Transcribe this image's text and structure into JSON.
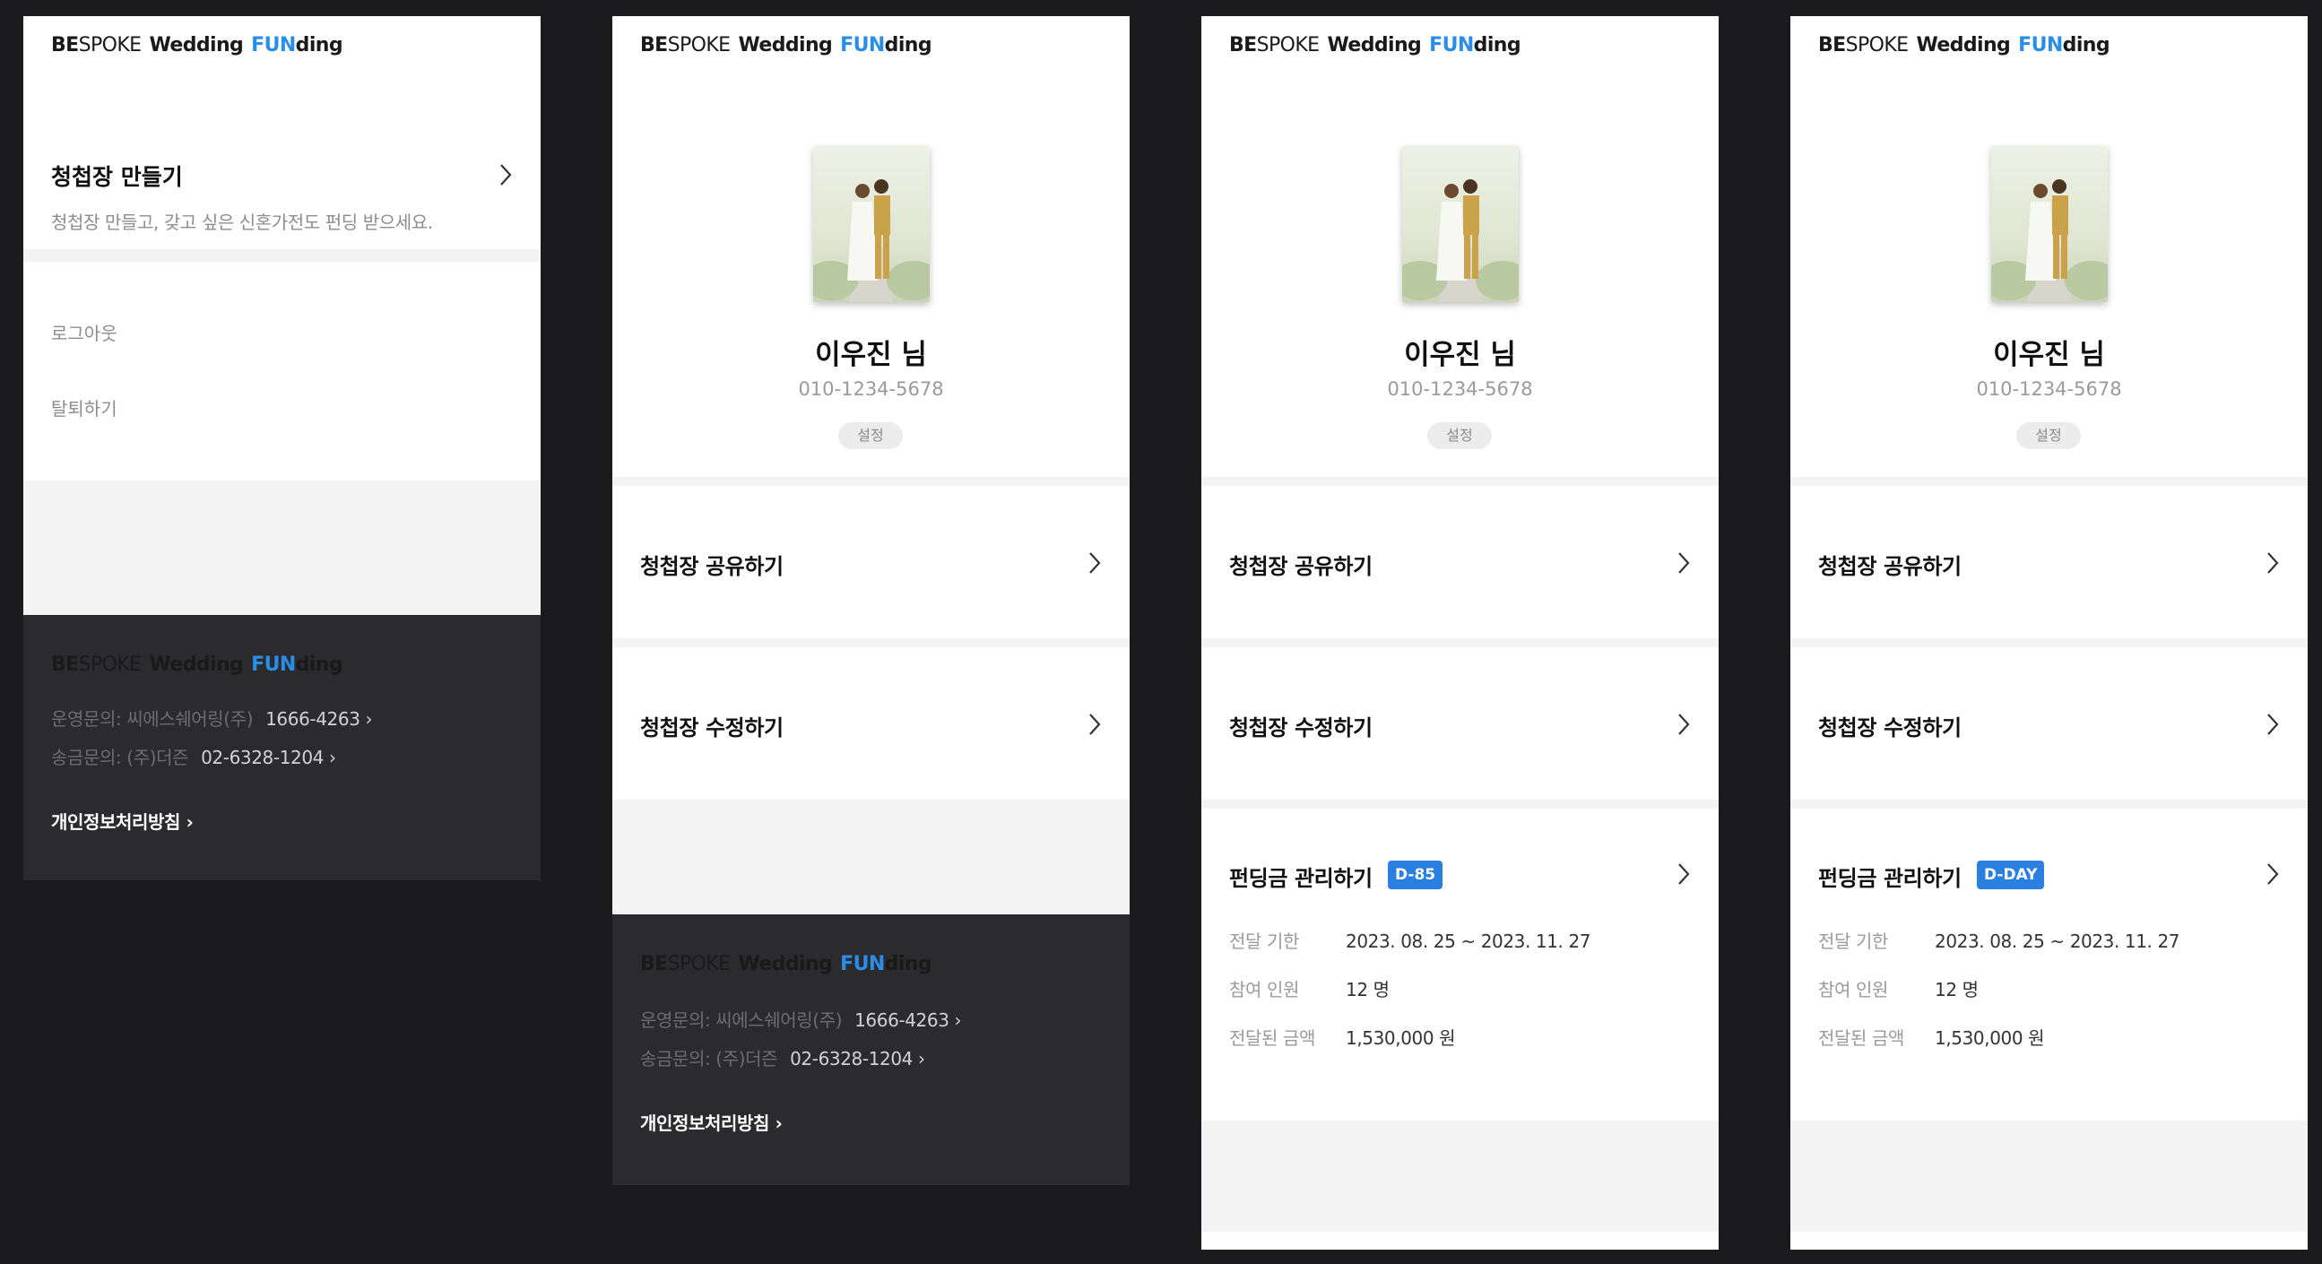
{
  "brand": {
    "logo_be": "BE",
    "logo_spoke": "SPOKE",
    "logo_wedding": "Wedding",
    "logo_fun": "FUN",
    "logo_ding": "ding",
    "accent_color": "#2a8de8"
  },
  "screen1": {
    "make_title": "청첩장 만들기",
    "make_subtitle": "청첩장 만들고, 갖고 싶은 신혼가전도 펀딩 받으세요.",
    "logout": "로그아웃",
    "withdraw": "탈퇴하기"
  },
  "footer": {
    "ops_label": "운영문의: 씨에스쉐어링(주)",
    "ops_phone": "1666-4263",
    "remit_label": "송금문의: (주)더즌",
    "remit_phone": "02-6328-1204",
    "arrow": "›",
    "privacy": "개인정보처리방침 ›"
  },
  "profile": {
    "name": "이우진 님",
    "phone": "010-1234-5678",
    "setting": "설정"
  },
  "menu": {
    "share": "청첩장 공유하기",
    "edit": "청첩장 수정하기",
    "fund": "펀딩금 관리하기"
  },
  "fund": {
    "badge_screen3": "D-85",
    "badge_screen4": "D-DAY",
    "period_label": "전달 기한",
    "period_value": "2023. 08. 25 ~ 2023. 11. 27",
    "participants_label": "참여 인원",
    "participants_value": "12 명",
    "amount_label": "전달된 금액",
    "amount_value": "1,530,000 원"
  }
}
